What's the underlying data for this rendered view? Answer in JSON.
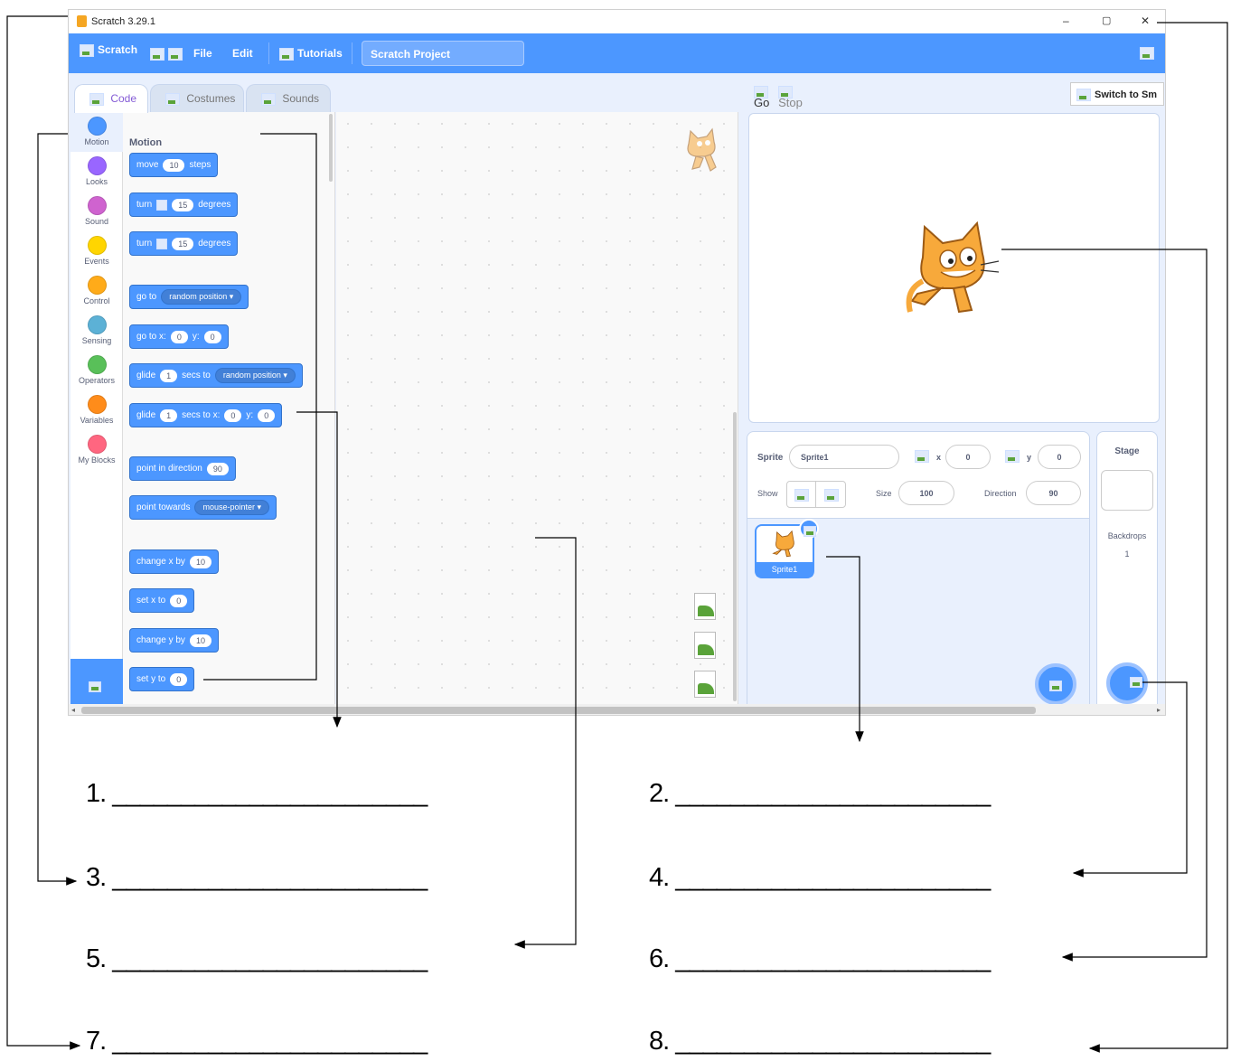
{
  "window": {
    "title": "Scratch 3.29.1",
    "controls": {
      "minimize": "–",
      "maximize": "▢",
      "close": "✕"
    }
  },
  "menu": {
    "logo": "Scratch",
    "file": "File",
    "edit": "Edit",
    "tutorials": "Tutorials",
    "project_title": "Scratch Project"
  },
  "tabs": [
    {
      "label": "Code"
    },
    {
      "label": "Costumes"
    },
    {
      "label": "Sounds"
    }
  ],
  "categories": [
    {
      "label": "Motion",
      "color": "#4c97ff"
    },
    {
      "label": "Looks",
      "color": "#9966ff"
    },
    {
      "label": "Sound",
      "color": "#cf63cf"
    },
    {
      "label": "Events",
      "color": "#ffd500"
    },
    {
      "label": "Control",
      "color": "#ffab19"
    },
    {
      "label": "Sensing",
      "color": "#5cb1d6"
    },
    {
      "label": "Operators",
      "color": "#59c059"
    },
    {
      "label": "Variables",
      "color": "#ff8c1a"
    },
    {
      "label": "My Blocks",
      "color": "#ff6680"
    }
  ],
  "palette": {
    "heading": "Motion",
    "blocks": {
      "move": {
        "a": "move",
        "v": "10",
        "b": "steps"
      },
      "turn_right": {
        "a": "turn",
        "v": "15",
        "b": "degrees"
      },
      "turn_left": {
        "a": "turn",
        "v": "15",
        "b": "degrees"
      },
      "goto": {
        "a": "go to",
        "d": "random position"
      },
      "gotoxy": {
        "a": "go to x:",
        "x": "0",
        "b": "y:",
        "y": "0"
      },
      "glide": {
        "a": "glide",
        "v": "1",
        "b": "secs to",
        "d": "random position"
      },
      "glidexy": {
        "a": "glide",
        "v": "1",
        "b": "secs to x:",
        "x": "0",
        "c": "y:",
        "y": "0"
      },
      "point_dir": {
        "a": "point in direction",
        "v": "90"
      },
      "point_towards": {
        "a": "point towards",
        "d": "mouse-pointer"
      },
      "change_x": {
        "a": "change x by",
        "v": "10"
      },
      "set_x": {
        "a": "set x to",
        "v": "0"
      },
      "change_y": {
        "a": "change y by",
        "v": "10"
      },
      "set_y": {
        "a": "set y to",
        "v": "0"
      }
    }
  },
  "stage_header": {
    "go": "Go",
    "stop": "Stop",
    "mode_text": "Switch to Sm"
  },
  "sprite_info": {
    "sprite_label": "Sprite",
    "sprite_name": "Sprite1",
    "x_label": "x",
    "x_value": "0",
    "y_label": "y",
    "y_value": "0",
    "show_label": "Show",
    "size_label": "Size",
    "size_value": "100",
    "direction_label": "Direction",
    "direction_value": "90"
  },
  "sprite_list": [
    {
      "name": "Sprite1"
    }
  ],
  "stage_pane": {
    "title": "Stage",
    "backdrops_label": "Backdrops",
    "backdrops_count": "1"
  },
  "worksheet": {
    "answers": [
      {
        "label": "1.",
        "blank": "_______________________"
      },
      {
        "label": "2.",
        "blank": "_______________________"
      },
      {
        "label": "3.",
        "blank": "_______________________"
      },
      {
        "label": "4.",
        "blank": "_______________________"
      },
      {
        "label": "5.",
        "blank": "_______________________"
      },
      {
        "label": "6.",
        "blank": "_______________________"
      },
      {
        "label": "7.",
        "blank": "_______________________"
      },
      {
        "label": "8.",
        "blank": "_______________________"
      }
    ]
  }
}
